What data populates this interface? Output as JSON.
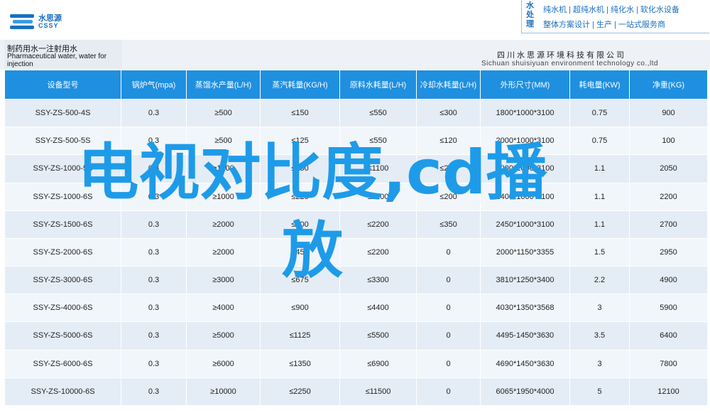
{
  "logo": {
    "cn": "水思源",
    "en": "CSSY"
  },
  "brand": {
    "vertical": "水处理",
    "line1": "纯水机 | 超纯水机 | 纯化水 | 软化水设备",
    "line2": "整体方案设计 | 生产 | 一站式服务商"
  },
  "product": {
    "name_cn": "制药用水一注射用水",
    "name_en": "Pharmaceutical water, water for injection"
  },
  "company": {
    "cn": "四川水思源环境科技有限公司",
    "en": "Sichuan shuisiyuan environment technology co.,ltd"
  },
  "table": {
    "headers": [
      "设备型号",
      "锅炉气(mpa)",
      "蒸馏水产量(L/H)",
      "蒸汽耗量(KG/H)",
      "原料水耗量(L/H)",
      "冷却水耗量(L/H)",
      "外形尺寸(MM)",
      "耗电量(KW)",
      "净重(KG)"
    ],
    "rows": [
      [
        "SSY-ZS-500-4S",
        "0.3",
        "≥500",
        "≤150",
        "≤550",
        "≤300",
        "1800*1000*3100",
        "0.75",
        "900"
      ],
      [
        "SSY-ZS-500-5S",
        "0.3",
        "≥500",
        "≤125",
        "≤550",
        "≤120",
        "2000*1000*3100",
        "0.75",
        "100"
      ],
      [
        "SSY-ZS-1000-5S",
        "0.3",
        "≥1000",
        "≤250",
        "≤1100",
        "≤250",
        "2000*1000*3100",
        "1.1",
        "2050"
      ],
      [
        "SSY-ZS-1000-6S",
        "0.3",
        "≥1000",
        "≤225",
        "≤1100",
        "≤200",
        "2400*1000*3100",
        "1.1",
        "2200"
      ],
      [
        "SSY-ZS-1500-6S",
        "0.3",
        "≥2000",
        "≤300",
        "≤2200",
        "≤350",
        "2450*1000*3100",
        "1.1",
        "2700"
      ],
      [
        "SSY-ZS-2000-6S",
        "0.3",
        "≥2000",
        "≤450",
        "≤2200",
        "0",
        "2000*1150*3355",
        "1.5",
        "2950"
      ],
      [
        "SSY-ZS-3000-6S",
        "0.3",
        "≥3000",
        "≤675",
        "≤3300",
        "0",
        "3810*1250*3400",
        "2.2",
        "4900"
      ],
      [
        "SSY-ZS-4000-6S",
        "0.3",
        "≥4000",
        "≤900",
        "≤4400",
        "0",
        "4030*1350*3568",
        "3",
        "5900"
      ],
      [
        "SSY-ZS-5000-6S",
        "0.3",
        "≥5000",
        "≤1125",
        "≤5500",
        "0",
        "4495-1450*3630",
        "3.5",
        "6400"
      ],
      [
        "SSY-ZS-6000-6S",
        "0.3",
        "≥6000",
        "≤1350",
        "≤6900",
        "0",
        "4690*1450*3630",
        "3",
        "7800"
      ],
      [
        "SSY-ZS-10000-6S",
        "0.3",
        "≥10000",
        "≤2250",
        "≤11500",
        "0",
        "6065*1950*4000",
        "5",
        "12100"
      ]
    ]
  },
  "overlay": {
    "line1": "电视对比度,cd播",
    "line2": "放"
  },
  "colors": {
    "header_blue": "#1f8fe0",
    "brand_blue": "#1a6fc0",
    "overlay_blue": "#1e9be8"
  }
}
